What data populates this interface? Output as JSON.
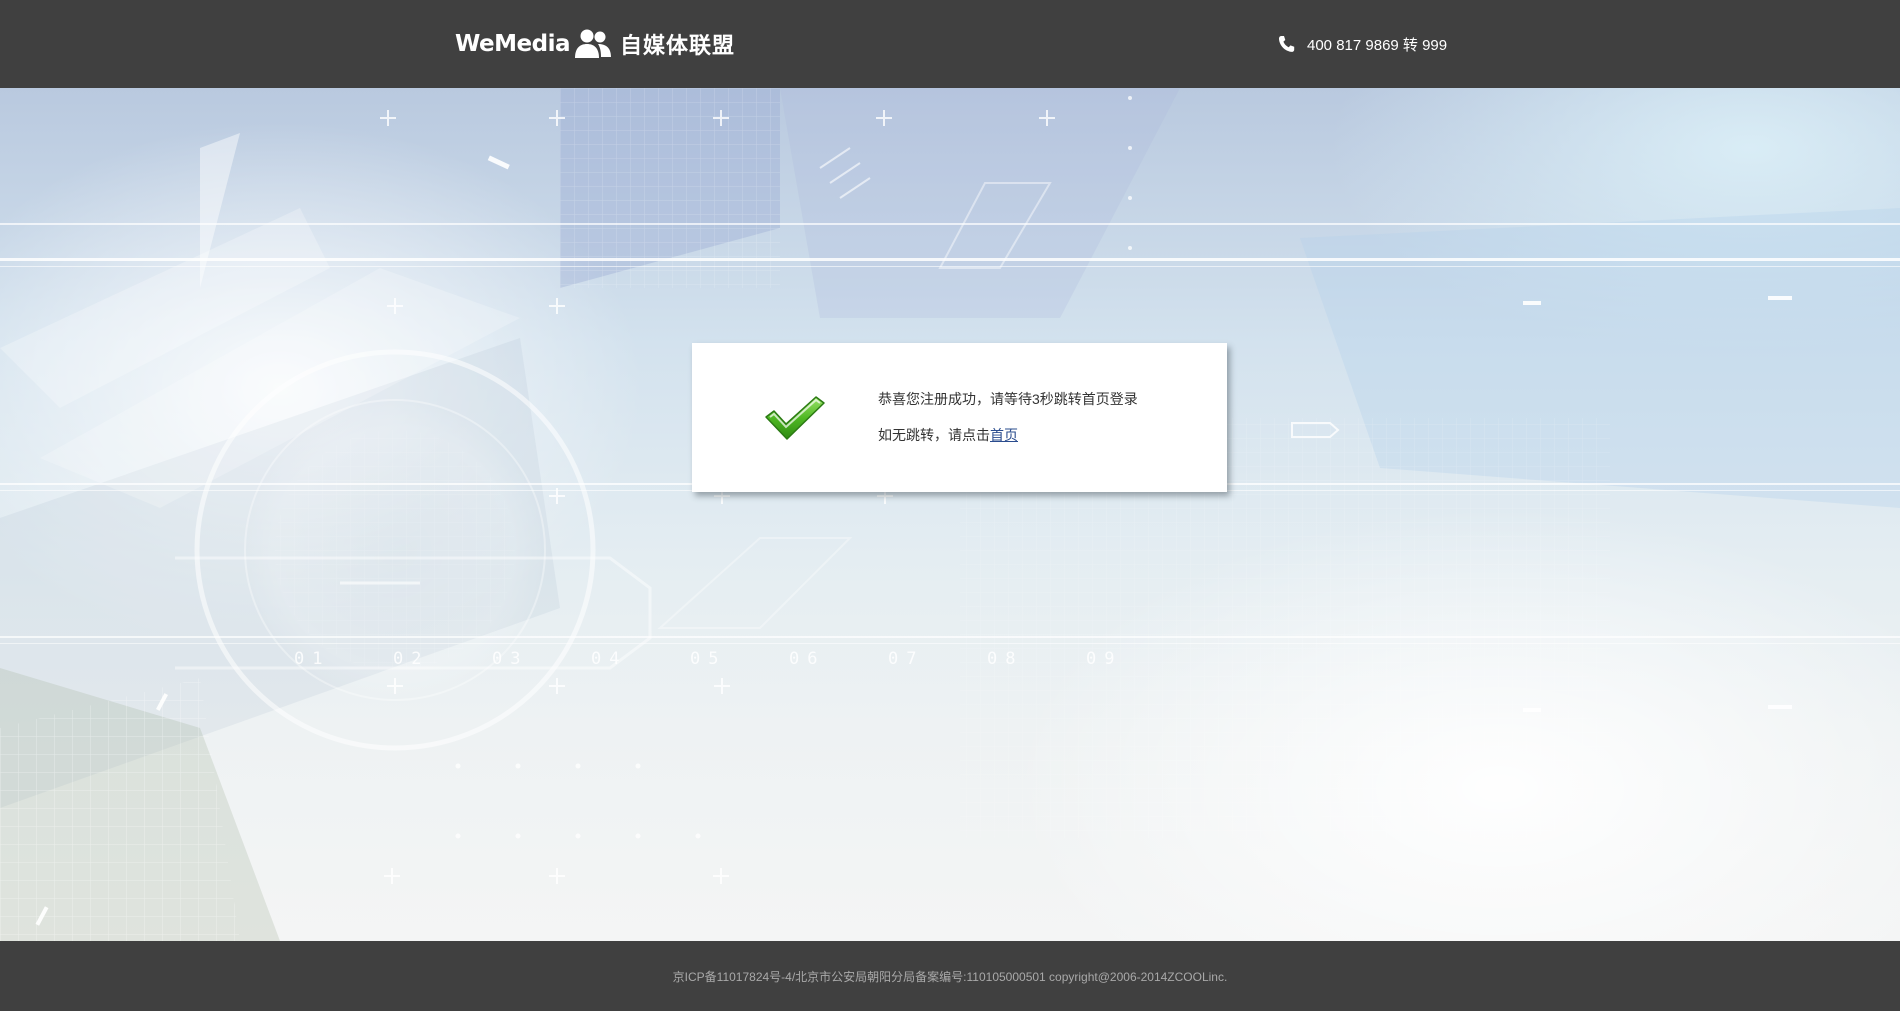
{
  "header": {
    "logo_en": "WeMedia",
    "logo_cn": "自媒体联盟",
    "logo_icon": "users-icon",
    "phone_icon": "phone-icon",
    "phone": "400 817 9869 转 999"
  },
  "dialog": {
    "icon": "checkmark-icon",
    "message": "恭喜您注册成功，请等待3秒跳转首页登录",
    "fallback_prefix": "如无跳转，请点击",
    "home_link": "首页"
  },
  "hero": {
    "scale_labels": [
      "01",
      "02",
      "03",
      "04",
      "05",
      "06",
      "07",
      "08",
      "09"
    ]
  },
  "footer": {
    "text": "京ICP备11017824号-4/北京市公安局朝阳分局备案编号:110105000501  copyright@2006-2014ZCOOLinc."
  },
  "colors": {
    "header_bg": "#404040",
    "footer_bg": "#404040",
    "link": "#2a4c8e",
    "check_green": "#5cbf2a"
  }
}
